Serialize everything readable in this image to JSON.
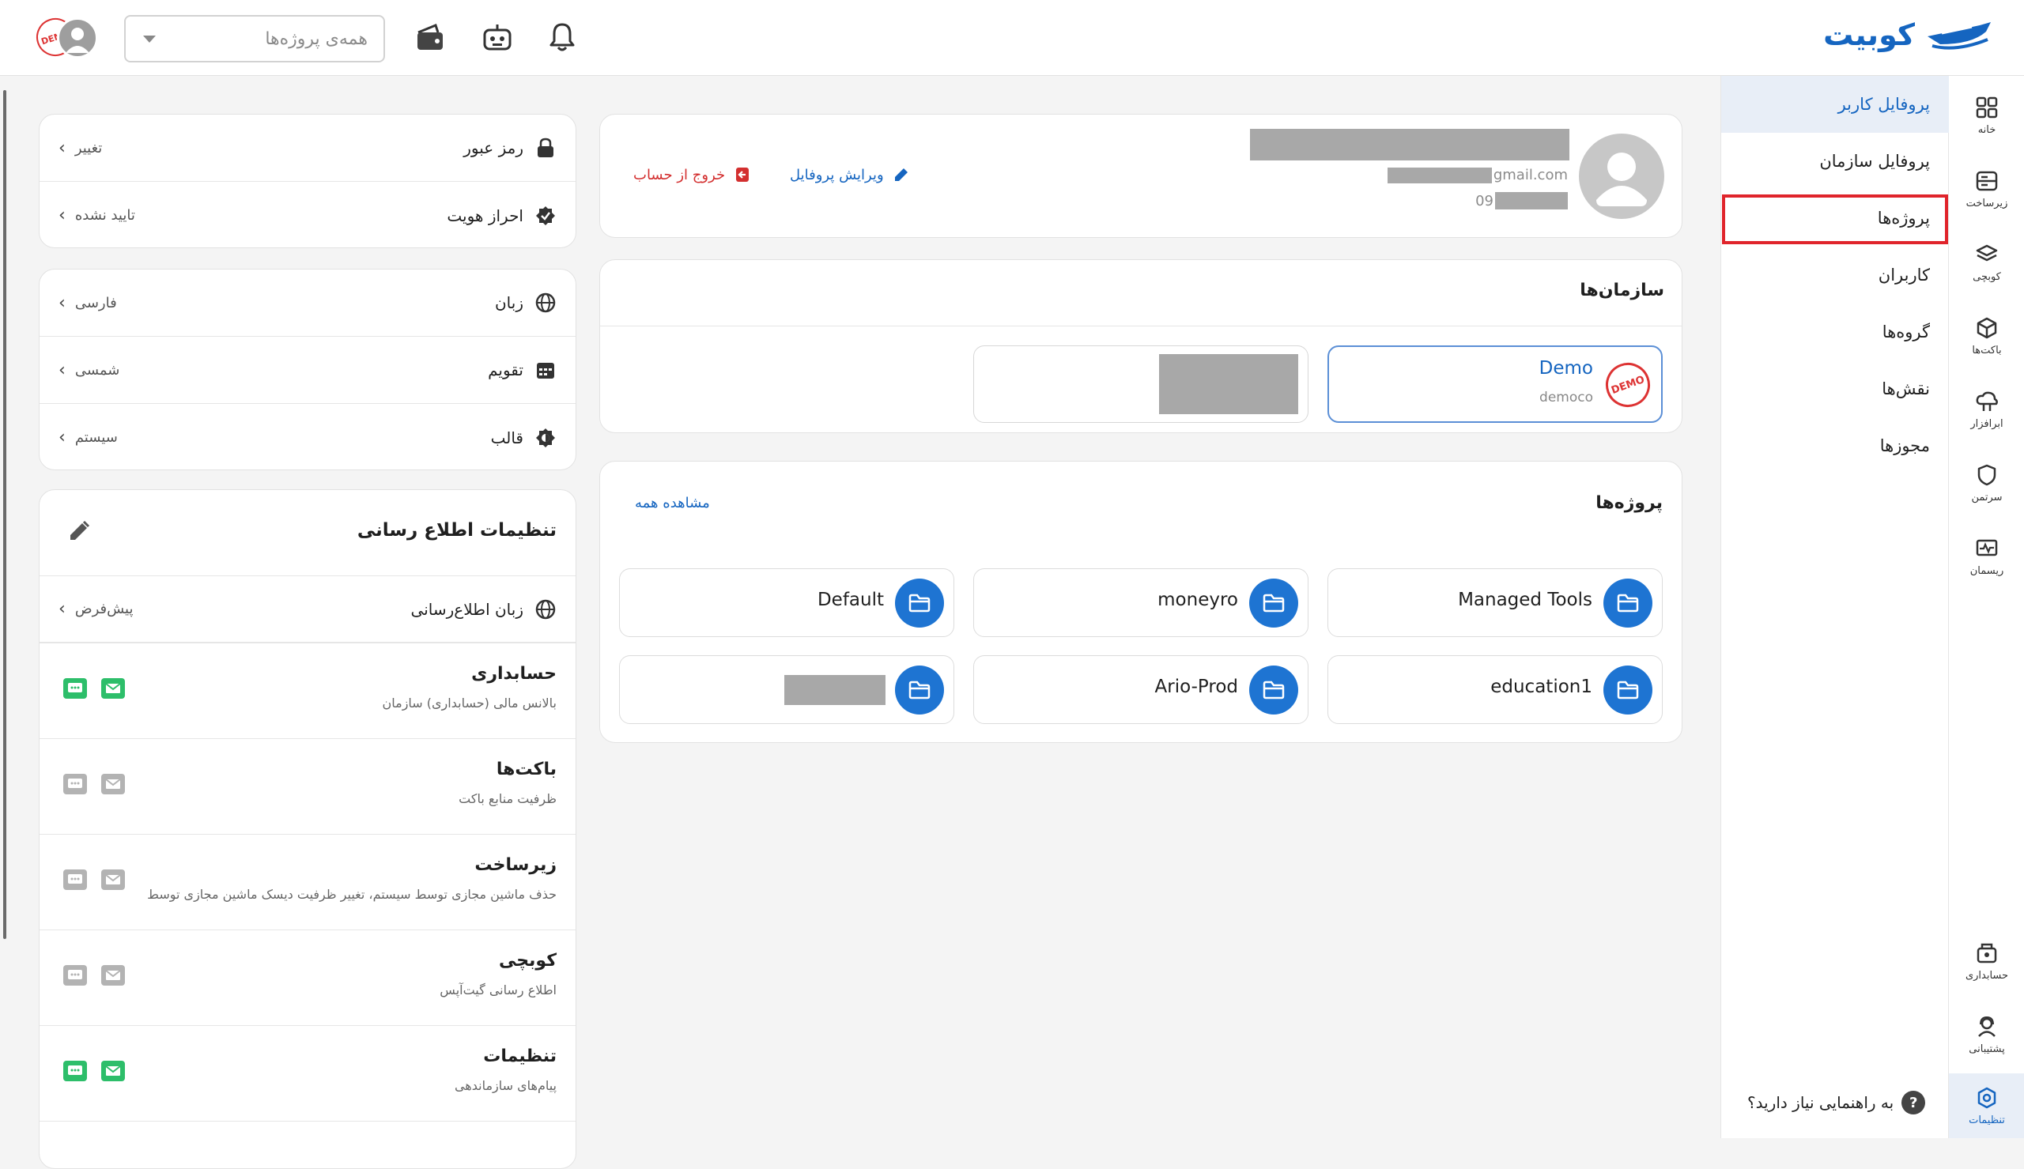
{
  "brand": {
    "name": "کوبیت",
    "color": "#1565c0"
  },
  "topbar": {
    "project_placeholder": "همه‌ی پروژه‌ها",
    "icons": [
      "bell-icon",
      "robot-icon",
      "wallet-icon"
    ],
    "avatar_badge": "DEMO"
  },
  "rail": {
    "items": [
      {
        "label": "خانه",
        "icon": "grid-icon"
      },
      {
        "label": "زیرساخت",
        "icon": "server-icon"
      },
      {
        "label": "کوبچی",
        "icon": "layers-icon"
      },
      {
        "label": "باکت‌ها",
        "icon": "cube-icon"
      },
      {
        "label": "ابرافزار",
        "icon": "cloud-app-icon"
      },
      {
        "label": "سرتمن",
        "icon": "shield-icon"
      },
      {
        "label": "ریسمان",
        "icon": "monitor-icon"
      },
      {
        "label": "حسابداری",
        "icon": "accounting-icon"
      },
      {
        "label": "پشتیبانی",
        "icon": "support-icon"
      },
      {
        "label": "تنظیمات",
        "icon": "settings-icon"
      }
    ],
    "active": "تنظیمات"
  },
  "subnav": {
    "items": [
      "پروفایل کاربر",
      "پروفایل سازمان",
      "پروژه‌ها",
      "کاربران",
      "گروه‌ها",
      "نقش‌ها",
      "مجوزها"
    ],
    "active": "پروفایل کاربر",
    "highlighted": "پروژه‌ها",
    "help": "به راهنمایی نیاز دارید؟"
  },
  "profile": {
    "email_suffix": "gmail.com",
    "phone_prefix": "09",
    "edit_label": "ویرایش پروفایل",
    "logout_label": "خروج از حساب"
  },
  "orgs": {
    "title": "سازمان‌ها",
    "items": [
      {
        "name": "Demo",
        "slug": "democo",
        "badge": "DEMO"
      }
    ]
  },
  "projects": {
    "title": "پروژه‌ها",
    "view_all": "مشاهده همه",
    "items": [
      "Managed Tools",
      "moneyro",
      "Default",
      "education1",
      "Ario-Prod",
      ""
    ]
  },
  "security": [
    {
      "label": "رمز عبور",
      "value": "تغییر",
      "icon": "lock-icon"
    },
    {
      "label": "احراز هویت",
      "value": "تایید نشده",
      "icon": "verified-icon"
    }
  ],
  "preferences": [
    {
      "label": "زبان",
      "value": "فارسی",
      "icon": "globe-icon"
    },
    {
      "label": "تقویم",
      "value": "شمسی",
      "icon": "calendar-icon"
    },
    {
      "label": "قالب",
      "value": "سیستم",
      "icon": "theme-icon"
    }
  ],
  "notifications": {
    "title": "تنظیمات اطلاع رسانی",
    "language_label": "زبان اطلاع‌رسانی",
    "language_value": "پیش‌فرض",
    "groups": [
      {
        "title": "حسابداری",
        "desc": "بالانس مالی (حسابداری) سازمان",
        "sms": true,
        "email": true
      },
      {
        "title": "باکت‌ها",
        "desc": "ظرفیت منابع باکت",
        "sms": false,
        "email": false
      },
      {
        "title": "زیرساخت",
        "desc": "حذف ماشین مجازی توسط سیستم، تغییر ظرفیت دیسک ماشین مجازی توسط",
        "sms": false,
        "email": false
      },
      {
        "title": "کوبچی",
        "desc": "اطلاع رسانی گیت‌آپس",
        "sms": false,
        "email": false
      },
      {
        "title": "تنظیمات",
        "desc": "پیام‌های سازماندهی",
        "sms": true,
        "email": true
      }
    ]
  },
  "colors": {
    "accent": "#1565c0",
    "danger": "#d32f2f",
    "success": "#2dbe6a",
    "highlight": "#e0242b"
  }
}
